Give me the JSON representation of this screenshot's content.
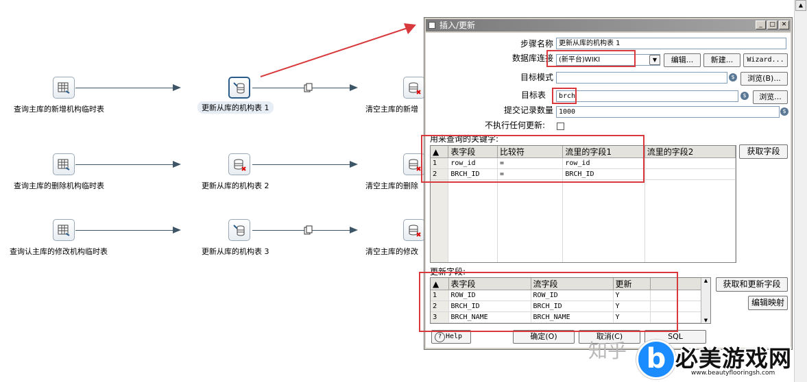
{
  "canvas": {
    "steps": [
      {
        "label": "查询主库的新增机构临时表",
        "icon": "table-input-icon"
      },
      {
        "label": "更新从库的机构表 1",
        "icon": "insert-update-icon",
        "selected": true
      },
      {
        "label": "清空主库的新增",
        "icon": "delete-icon"
      },
      {
        "label": "查询主库的删除机构临时表",
        "icon": "table-input-icon"
      },
      {
        "label": "更新从库的机构表 2",
        "icon": "delete-icon"
      },
      {
        "label": "清空主库的删除",
        "icon": "delete-icon"
      },
      {
        "label": "查询认主库的修改机构临时表",
        "icon": "table-input-icon"
      },
      {
        "label": "更新从库的机构表 3",
        "icon": "insert-update-icon"
      },
      {
        "label": "清空主库的修改",
        "icon": "delete-icon"
      }
    ]
  },
  "dialog": {
    "title": "插入/更新",
    "step_name_label": "步骤名称",
    "step_name_value": "更新从库的机构表 1",
    "connection_label": "数据库连接",
    "connection_value": "(新平台)WIKI",
    "edit_button": "编辑...",
    "new_button": "新建...",
    "wizard_button": "Wizard...",
    "schema_label": "目标模式",
    "schema_value": "",
    "browse_schema_button": "浏览(B)...",
    "target_table_label": "目标表",
    "target_table_value": "brch",
    "browse_table_button": "浏览...",
    "commit_size_label": "提交记录数量",
    "commit_size_value": "1000",
    "no_update_label": "不执行任何更新:",
    "key_section_label": "用来查询的关键字:",
    "key_columns": [
      "#",
      "表字段",
      "比较符",
      "流里的字段1",
      "流里的字段2"
    ],
    "key_rows": [
      [
        "1",
        "row_id",
        "=",
        "row_id",
        ""
      ],
      [
        "2",
        "BRCH_ID",
        "=",
        "BRCH_ID",
        ""
      ]
    ],
    "get_fields_button": "获取字段",
    "update_section_label": "更新字段:",
    "update_columns": [
      "#",
      "表字段",
      "流字段",
      "更新"
    ],
    "update_rows": [
      [
        "1",
        "ROW_ID",
        "ROW_ID",
        "Y"
      ],
      [
        "2",
        "BRCH_ID",
        "BRCH_ID",
        "Y"
      ],
      [
        "3",
        "BRCH_NAME",
        "BRCH_NAME",
        "Y"
      ]
    ],
    "get_update_fields_button": "获取和更新字段",
    "edit_mapping_button": "编辑映射",
    "help_button": "Help",
    "ok_button": "确定(O)",
    "cancel_button": "取消(C)",
    "sql_button": "SQL"
  },
  "watermark": {
    "zhihu": "知乎",
    "brand": "必美游戏网",
    "url": "www.beautyflooringsh.com"
  },
  "colors": {
    "highlight": "#d8393d",
    "arrow": "#d8393d",
    "hop": "#3d5566"
  }
}
